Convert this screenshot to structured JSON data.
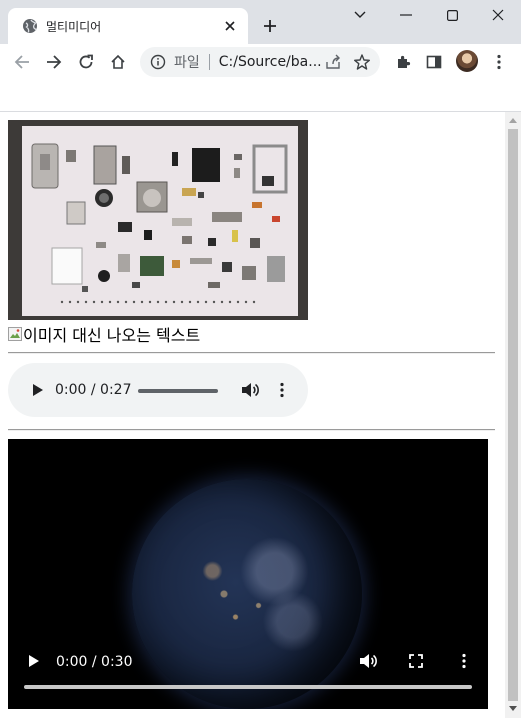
{
  "tab": {
    "title": "멀티미디어",
    "favicon": "globe-icon",
    "close": "close-icon"
  },
  "toolbar": {
    "back": "back-arrow-icon",
    "forward": "forward-arrow-icon",
    "reload": "reload-icon",
    "home": "home-icon",
    "address": {
      "chip_label": "파일",
      "url": "C:/Source/ba..."
    },
    "extensions": "puzzle-icon",
    "side_panel": "side-panel-icon",
    "menu": "more-vert-icon"
  },
  "window_controls": [
    "chevron-down-icon",
    "minimize-icon",
    "maximize-icon",
    "close-window-icon"
  ],
  "page": {
    "image_alt_text": "이미지 대신 나오는 텍스트",
    "audio": {
      "time": "0:00 / 0:27"
    },
    "video": {
      "time": "0:00 / 0:30"
    }
  },
  "colors": {
    "tabstrip": "#dee1e6",
    "omnibox": "#f1f3f4",
    "audio_bg": "#f1f3f4",
    "video_bg": "#000000"
  }
}
